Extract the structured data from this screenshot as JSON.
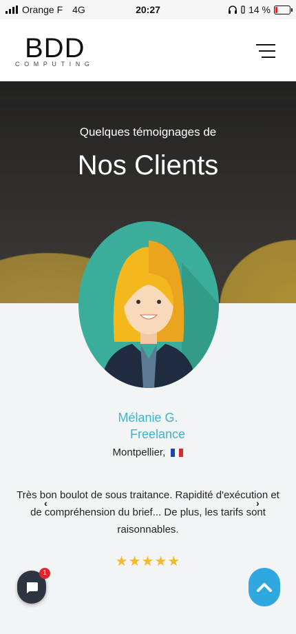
{
  "status_bar": {
    "carrier": "Orange F",
    "network": "4G",
    "time": "20:27",
    "battery": "14 %",
    "battery_level": 0.14,
    "battery_color": "#e0262c"
  },
  "header": {
    "logo_main": "BDD",
    "logo_sub": "COMPUTING",
    "menu_icon": "hamburger-menu-icon"
  },
  "hero": {
    "subtitle": "Quelques témoignages de",
    "title": "Nos Clients"
  },
  "testimonial": {
    "name": "Mélanie G.",
    "role": "Freelance",
    "location": "Montpellier,",
    "flag_icon": "french-flag-icon",
    "quote": "Très bon boulot de sous traitance. Rapidité d'exécution et de compréhension du brief... De plus, les tarifs sont raisonnables.",
    "rating": 5,
    "rating_text": "★★★★★",
    "prev_arrow": "‹",
    "next_arrow": "›"
  },
  "chat": {
    "badge_count": "1"
  },
  "colors": {
    "accent": "#3fb3cc",
    "star": "#f5b82e",
    "scroll_top": "#2fa7df",
    "chat_bg": "#2e3540"
  }
}
